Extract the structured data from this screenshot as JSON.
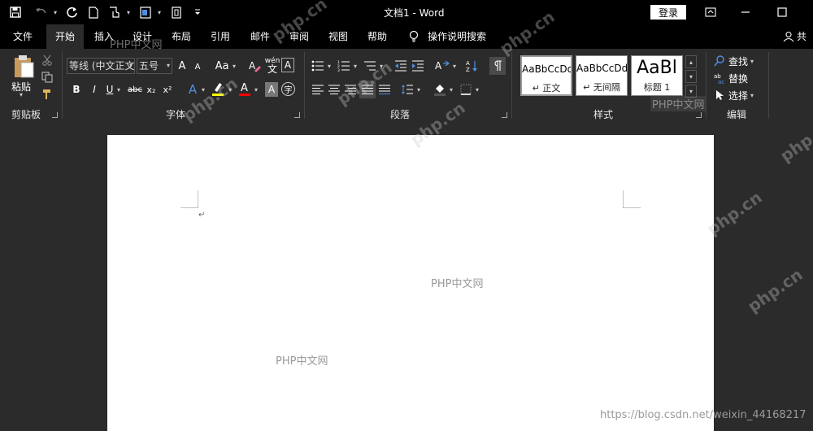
{
  "titlebar": {
    "doc_title": "文档1  -  Word",
    "login_label": "登录"
  },
  "tabs": [
    "文件",
    "开始",
    "插入",
    "设计",
    "布局",
    "引用",
    "邮件",
    "审阅",
    "视图",
    "帮助",
    "操作说明搜索",
    "共享"
  ],
  "active_tab": "开始",
  "groups": {
    "clipboard": {
      "label": "剪贴板",
      "paste_label": "粘贴"
    },
    "font": {
      "label": "字体",
      "font_name": "等线 (中文正文",
      "font_size": "五号"
    },
    "paragraph": {
      "label": "段落"
    },
    "styles": {
      "label": "样式",
      "items": [
        {
          "sample": "AaBbCcDd",
          "name": "↵ 正文"
        },
        {
          "sample": "AaBbCcDd",
          "name": "↵ 无间隔"
        },
        {
          "sample": "AaBl",
          "name": "标题 1"
        }
      ]
    },
    "editing": {
      "label": "编辑",
      "find": "查找",
      "replace": "替换",
      "select": "选择"
    }
  },
  "icons": {
    "bold": "B",
    "italic": "I",
    "underline": "U",
    "strike": "abc",
    "subscript": "x₂",
    "superscript": "x²",
    "grow": "A",
    "shrink": "A",
    "case": "Aa",
    "clear": "A",
    "pinyin": "wén",
    "border": "A",
    "texteffect": "A",
    "highlight": "ab",
    "fontcolor": "A",
    "shade": "A",
    "circle": "字"
  },
  "watermarks": {
    "page1": "PHP中文网",
    "page2": "PHP中文网",
    "ribbon1": "PHP中文网",
    "ribbon2": "PHP中文网",
    "diag": [
      "php.cn",
      "php.cn",
      "php.cn",
      "php.cn",
      "php.cn",
      "php.cn",
      "php.cn",
      "php.cn"
    ],
    "csdn": "https://blog.csdn.net/weixin_44168217"
  },
  "colors": {
    "accent_blue": "#4f8fe3",
    "highlight_yellow": "#ffff00",
    "fontcolor_red": "#ff0000",
    "titlebar": "#000000",
    "ribbon": "#2b2b2b"
  }
}
